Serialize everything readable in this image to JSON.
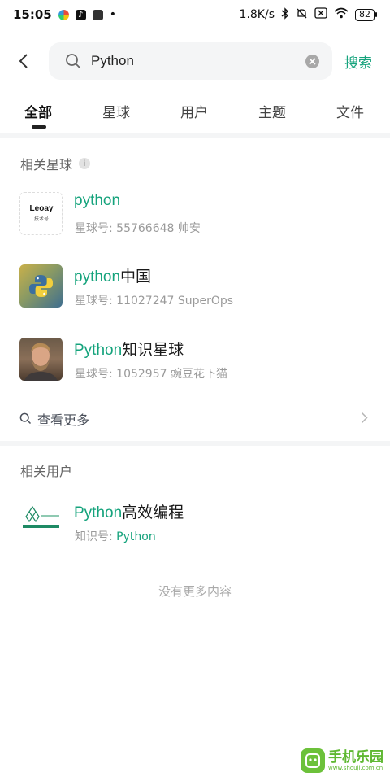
{
  "status_bar": {
    "time": "15:05",
    "network_speed": "1.8K/s",
    "battery": "82",
    "app_icons": [
      "pinwheel-app-icon",
      "tiktok-icon",
      "media-app-icon"
    ]
  },
  "search": {
    "query": "Python",
    "action_label": "搜索"
  },
  "tabs": [
    {
      "label": "全部",
      "active": true
    },
    {
      "label": "星球",
      "active": false
    },
    {
      "label": "用户",
      "active": false
    },
    {
      "label": "主题",
      "active": false
    },
    {
      "label": "文件",
      "active": false
    }
  ],
  "planets_section": {
    "title": "相关星球",
    "items": [
      {
        "title_highlight": "python",
        "title_rest": "",
        "sub": "星球号: 55766648   帅安",
        "thumb": "leoay-logo"
      },
      {
        "title_highlight": "python",
        "title_rest": "中国",
        "sub": "星球号: 11027247   SuperOps",
        "thumb": "python-logo"
      },
      {
        "title_highlight": "Python",
        "title_rest": "知识星球",
        "sub": "星球号: 1052957   豌豆花下猫",
        "thumb": "person-avatar"
      }
    ],
    "more_label": "查看更多"
  },
  "users_section": {
    "title": "相关用户",
    "items": [
      {
        "title_highlight": "Python",
        "title_rest": "高效编程",
        "sub_prefix": "知识号: ",
        "sub_highlight": "Python",
        "thumb": "python-gongzhonghao-logo"
      }
    ]
  },
  "end_text": "没有更多内容",
  "watermark": {
    "name": "手机乐园",
    "url": "www.shouji.com.cn"
  },
  "colors": {
    "accent": "#15a37c",
    "divider": "#f4f5f6",
    "muted": "#9a9a9a"
  }
}
